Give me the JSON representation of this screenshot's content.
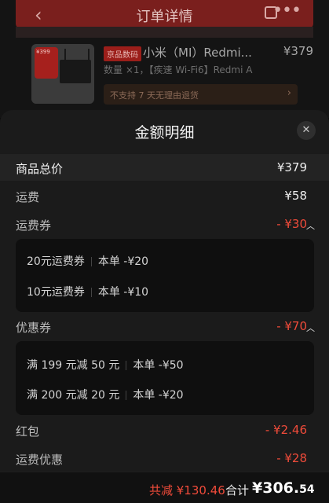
{
  "header": {
    "title": "订单详情"
  },
  "order": {
    "category_tag": "京品数码",
    "product_name": "小米（MI）Redmi...",
    "price": "¥379",
    "spec": "数量 ×1，【疾速 Wi-Fi6】Redmi A",
    "return_note": "不支持 7 天无理由退货",
    "thumb_badge": "¥399"
  },
  "sheet": {
    "title": "金额明细",
    "rows": {
      "goods_total": {
        "label": "商品总价",
        "value": "¥379"
      },
      "shipping": {
        "label": "运费",
        "value": "¥58"
      },
      "shipping_coupon": {
        "label": "运费券",
        "value": "- ¥30"
      },
      "coupon": {
        "label": "优惠券",
        "value": "- ¥70"
      },
      "red_packet": {
        "label": "红包",
        "value": "- ¥2.46"
      },
      "shipping_discount": {
        "label": "运费优惠",
        "value": "- ¥28"
      }
    },
    "shipping_coupon_items": [
      {
        "name": "20元运费券",
        "detail": "本单 -¥20"
      },
      {
        "name": "10元运费券",
        "detail": "本单 -¥10"
      }
    ],
    "coupon_items": [
      {
        "name": "满 199 元减 50 元",
        "detail": "本单 -¥50"
      },
      {
        "name": "满 200 元减 20 元",
        "detail": "本单 -¥20"
      }
    ]
  },
  "footer": {
    "discount": "共减 ¥130.46",
    "total_label": "合计",
    "total_main": "¥306.",
    "total_cents": "54"
  },
  "colors": {
    "accent_red": "#f04b3a",
    "sheet_bg": "#1b1b1b"
  }
}
